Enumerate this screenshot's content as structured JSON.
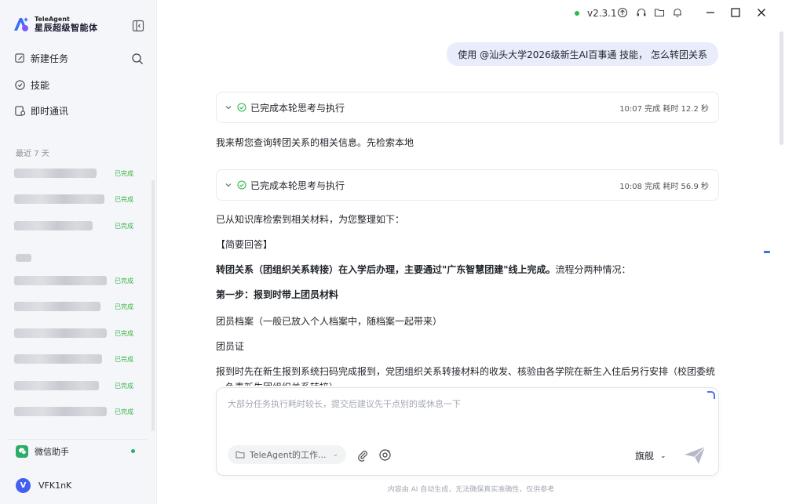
{
  "app": {
    "brand_en": "TeleAgent",
    "brand_cn": "星辰超级智能体",
    "version": "v2.3.1"
  },
  "sidebar": {
    "nav": [
      {
        "label": "新建任务",
        "icon": "edit-icon"
      },
      {
        "label": "技能",
        "icon": "skill-icon"
      },
      {
        "label": "即时通讯",
        "icon": "chat-icon"
      }
    ],
    "recent_label": "最近 7 天",
    "history_status": "已完成",
    "wechat_label": "微信助手",
    "user_initial": "V",
    "user_name": "VFK1nK"
  },
  "chat": {
    "user_message": "使用 @汕头大学2026级新生AI百事通 技能， 怎么转团关系",
    "steps": [
      {
        "title": "已完成本轮思考与执行",
        "meta": "10:07 完成 耗时 12.2 秒"
      },
      {
        "title": "已完成本轮思考与执行",
        "meta": "10:08 完成 耗时 56.9 秒"
      }
    ],
    "reply1": "我来帮您查询转团关系的相关信息。先检索本地",
    "reply2_intro": "已从知识库检索到相关材料，为您整理如下：",
    "reply2_heading": "【简要回答】",
    "reply2_bold": "转团关系（团组织关系转接）在入学后办理，主要通过\"广东智慧团建\"线上完成。",
    "reply2_rest": "流程分两种情况：",
    "reply2_step1": "第一步：报到时带上团员材料",
    "reply2_item1": "团员档案（一般已放入个人档案中，随档案一起带来）",
    "reply2_item2": "团员证",
    "reply2_para": "报到时先在新生报到系统扫码完成报到，党团组织关系转接材料的收发、核验由各学院在新生入住后另行安排（校团委统一负责新生团组织关系转接）"
  },
  "input": {
    "placeholder": "大部分任务执行耗时较长，提交后建议先干点别的或休息一下",
    "workspace": "TeleAgent的工作...",
    "model": "旗舰",
    "disclaimer": "内容由 AI 自动生成，无法确保真实准确性，仅供参考"
  },
  "colors": {
    "accent": "#4361ee",
    "success": "#3bb34a",
    "bubble": "#e8ecfb"
  }
}
